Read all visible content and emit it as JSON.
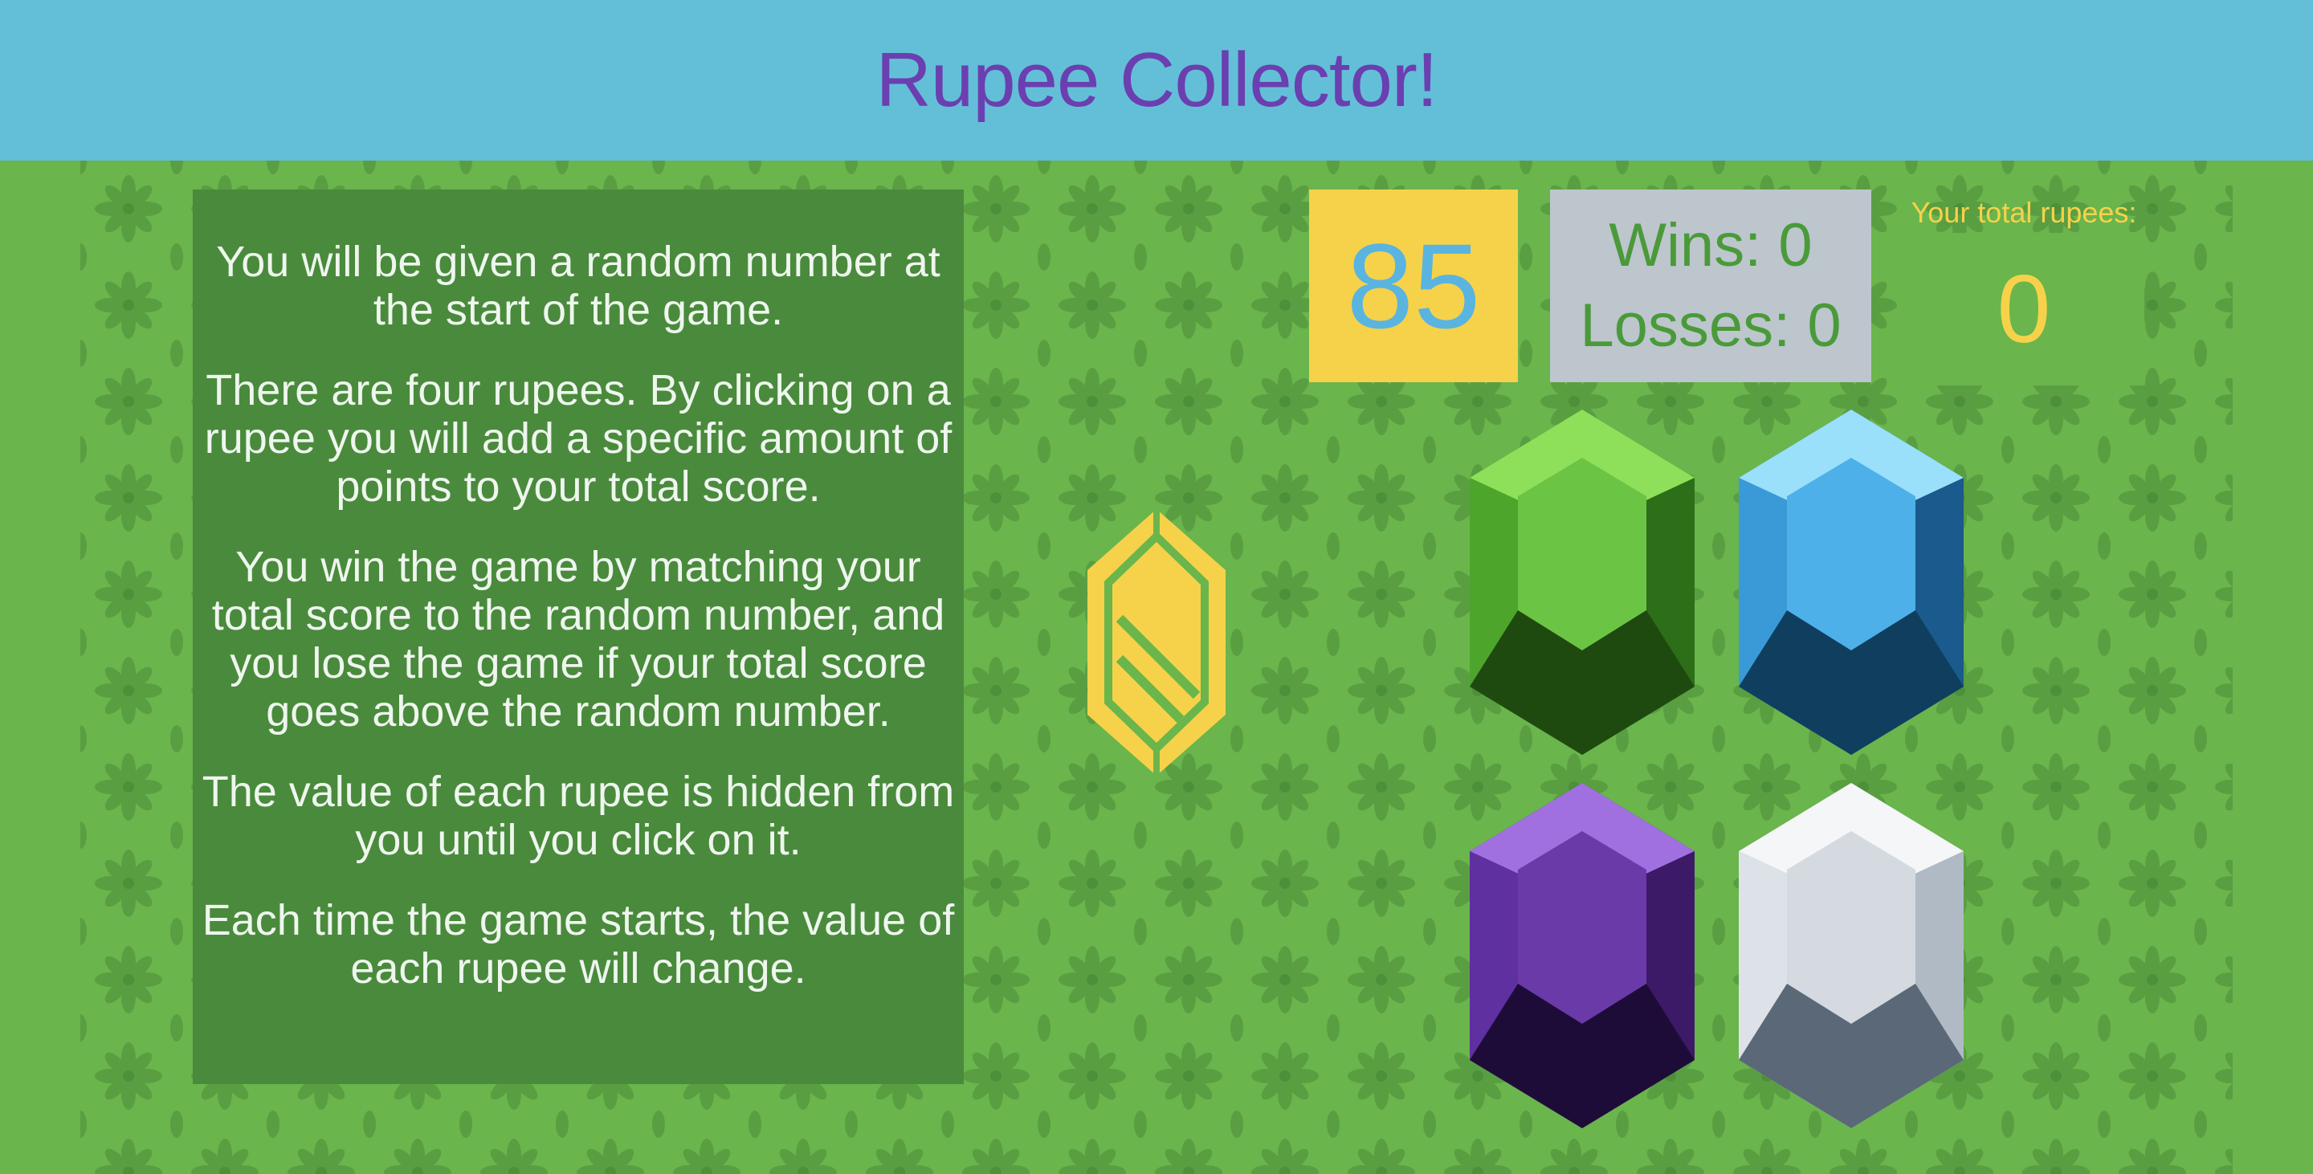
{
  "header": {
    "title": "Rupee Collector!"
  },
  "instructions": {
    "paragraphs": [
      "You will be given a random number at the start of the game.",
      "There are four rupees. By clicking on a rupee you will add a specific amount of points to your total score.",
      "You win the game by matching your total score to the random number, and you lose the game if your total score goes above the random number.",
      "The value of each rupee is hidden from you until you click on it.",
      "Each time the game starts, the value of each rupee will change."
    ]
  },
  "stats": {
    "target_number": "85",
    "wins": "Wins: 0",
    "losses": "Losses: 0",
    "total_label": "Your total rupees:",
    "total_value": "0"
  },
  "rupees": [
    {
      "name": "green",
      "color": "#58b83a"
    },
    {
      "name": "blue",
      "color": "#3a9ad8"
    },
    {
      "name": "purple",
      "color": "#6a3aa8"
    },
    {
      "name": "white",
      "color": "#c8d0d8"
    }
  ],
  "colors": {
    "header_bg": "#63bfd8",
    "title": "#6b3fb0",
    "field_bg": "#6ab54c",
    "panel_bg": "#4a8a3c",
    "accent_yellow": "#f6d24a",
    "score_bg": "#bcc6cc"
  },
  "icons": [
    "rupee-logo-icon",
    "flower-pattern-icon"
  ]
}
